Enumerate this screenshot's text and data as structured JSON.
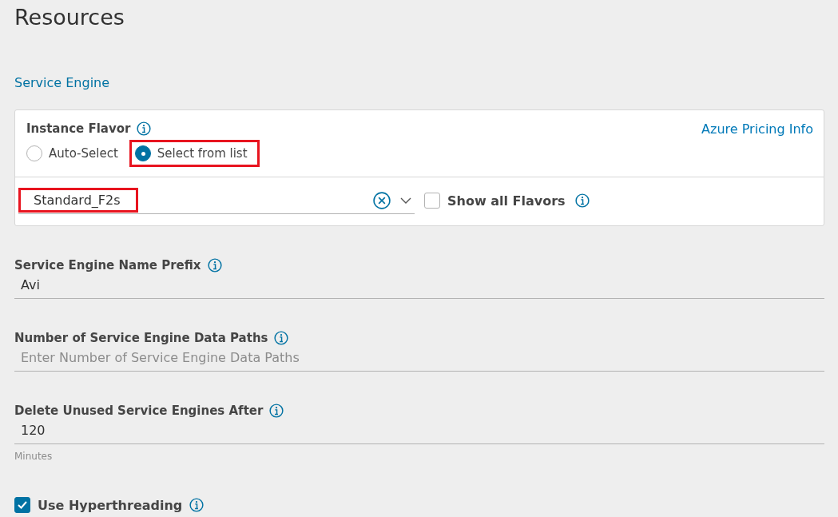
{
  "page": {
    "title": "Resources"
  },
  "section": {
    "title": "Service Engine"
  },
  "flavor": {
    "label": "Instance Flavor",
    "link": "Azure Pricing Info",
    "options": [
      {
        "label": "Auto-Select",
        "selected": false,
        "highlighted": false
      },
      {
        "label": "Select from list",
        "selected": true,
        "highlighted": true
      }
    ],
    "select": {
      "value": "Standard_F2s",
      "highlighted": true
    },
    "show_all": {
      "label": "Show all Flavors",
      "checked": false
    }
  },
  "fields": [
    {
      "label": "Service Engine Name Prefix",
      "value": "Avi"
    },
    {
      "label": "Number of Service Engine Data Paths",
      "placeholder": "Enter Number of Service Engine Data Paths"
    },
    {
      "label": "Delete Unused Service Engines After",
      "value": "120",
      "hint": "Minutes"
    }
  ],
  "hyperthreading": {
    "label": "Use Hyperthreading",
    "checked": true
  }
}
